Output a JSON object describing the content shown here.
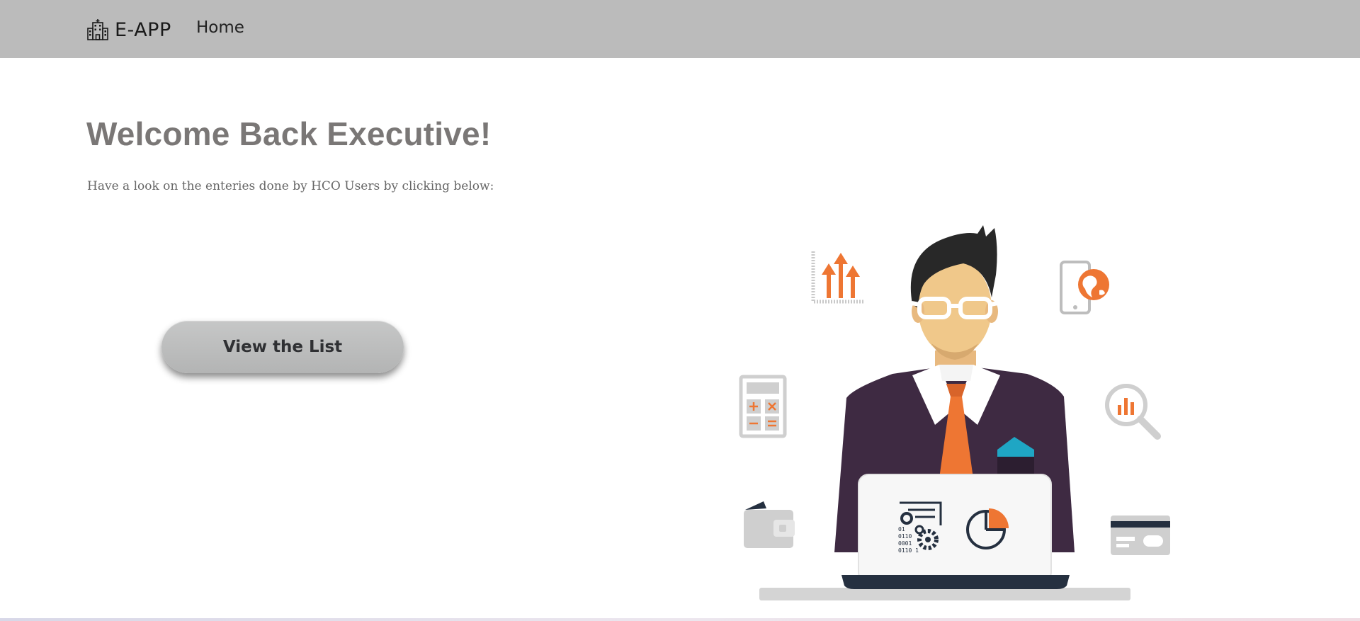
{
  "navbar": {
    "brand_text": "E-APP",
    "brand_icon": "hospital-building-icon",
    "home_label": "Home",
    "background": "#bbbbbb"
  },
  "main": {
    "title": "Welcome Back Executive!",
    "subtitle": "Have a look on the enteries done by HCO Users by clicking below:",
    "view_button_label": "View the List",
    "title_color": "#7a7776"
  },
  "illustration": {
    "description_icon": "businessman-laptop-illustration",
    "accent_color": "#ee7633",
    "suit_color": "#3e2a42"
  }
}
